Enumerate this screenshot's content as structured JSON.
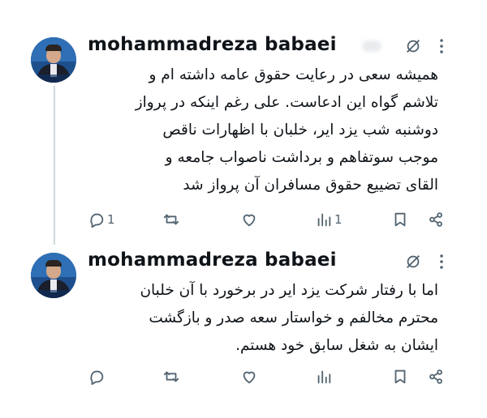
{
  "tweets": [
    {
      "author": "mohammadreza babaei",
      "text": "همیشه سعی در رعایت حقوق عامه داشته ام و\nتلاشم گواه این ادعاست. علی رغم اینکه در پرواز\nدوشنبه شب یزد ایر، خلبان با اظهارات ناقص\nموجب سوتفاهم و برداشت ناصواب جامعه و\nالقای تضییع حقوق مسافران آن پرواز شد",
      "reply_count": "1",
      "view_count": "1"
    },
    {
      "author": "mohammadreza babaei",
      "text": "اما با رفتار شرکت یزد ایر در برخورد با آن خلبان\nمحترم مخالفم و خواستار سعه صدر و بازگشت\nایشان به شغل سابق خود هستم.",
      "reply_count": "",
      "view_count": ""
    }
  ],
  "icons": {
    "reply": "reply-icon",
    "retweet": "retweet-icon",
    "like": "like-icon",
    "views": "views-icon",
    "bookmark": "bookmark-icon",
    "share": "share-icon",
    "grok": "grok-icon",
    "more": "more-icon"
  },
  "colors": {
    "text": "#0f1419",
    "muted": "#536471",
    "thread_line": "#cfd9de"
  }
}
